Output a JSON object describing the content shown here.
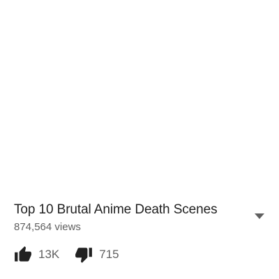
{
  "video": {
    "title": "Top 10 Brutal Anime Death Scenes",
    "views": "874,564 views"
  },
  "actions": {
    "like_count": "13K",
    "dislike_count": "715",
    "like_icon": "thumb-up-icon",
    "dislike_icon": "thumb-down-icon",
    "expand_icon": "chevron-down-icon"
  },
  "colors": {
    "title": "#212121",
    "secondary_text": "#606060",
    "icon": "#212121",
    "background": "#ffffff"
  }
}
